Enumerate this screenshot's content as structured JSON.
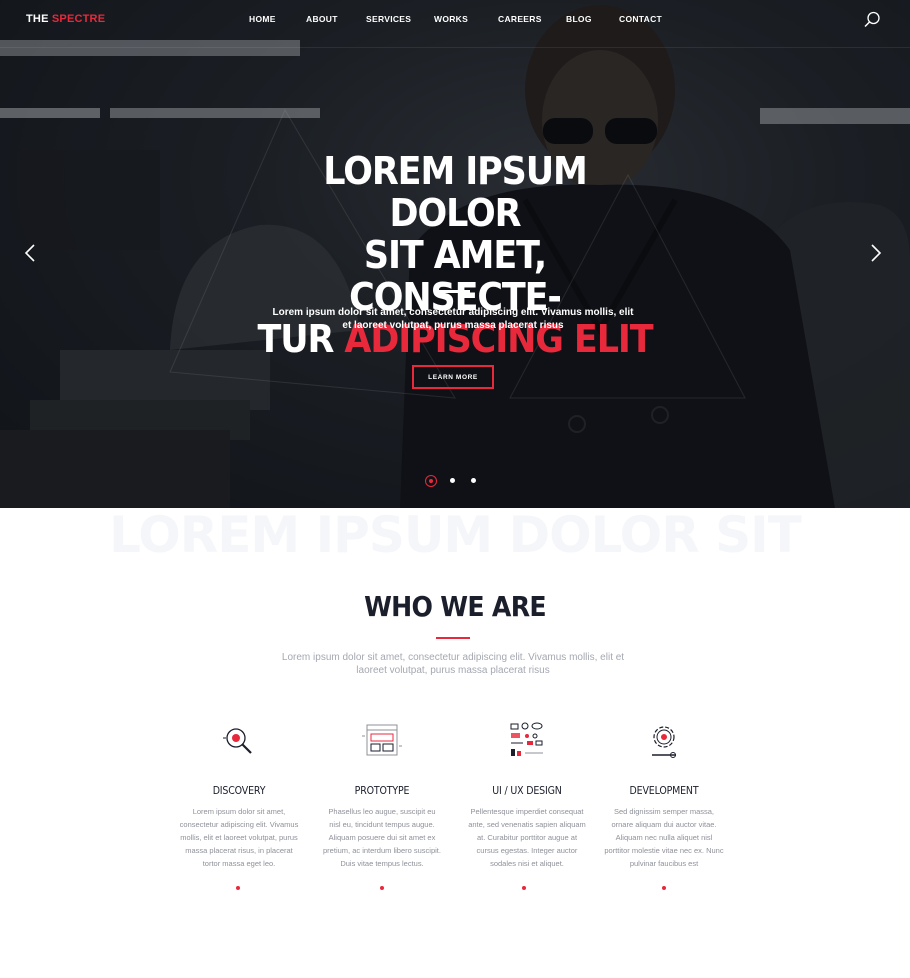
{
  "brand": {
    "part1": "THE",
    "part2": "SPECTRE"
  },
  "nav": {
    "items": [
      {
        "label": "HOME"
      },
      {
        "label": "ABOUT"
      },
      {
        "label": "SERVICES"
      },
      {
        "label": "WORKS"
      },
      {
        "label": "CAREERS"
      },
      {
        "label": "BLOG"
      },
      {
        "label": "CONTACT"
      }
    ],
    "search_icon": "search-icon"
  },
  "hero": {
    "title_line1": "LOREM IPSUM DOLOR",
    "title_line2": "SIT AMET, CONSECTE-",
    "title_line3_white": "TUR ",
    "title_line3_red": "ADIPISCING ELIT",
    "subtitle": "Lorem ipsum dolor sit amet, consectetur adipiscing elit. Vivamus mollis, elit et laoreet volutpat, purus massa placerat risus",
    "button_label": "LEARN MORE",
    "slides_total": 3,
    "active_slide": 1
  },
  "about": {
    "watermark": "LOREM IPSUM DOLOR SIT",
    "title": "WHO WE ARE",
    "subtitle": "Lorem ipsum dolor sit amet, consectetur adipiscing elit. Vivamus mollis, elit et laoreet volutpat, purus massa placerat risus",
    "features": [
      {
        "title": "DISCOVERY",
        "icon": "magnifier-icon",
        "text": "Lorem ipsum dolor sit amet, consectetur adipiscing elit. Vivamus mollis, elit et laoreet volutpat, purus massa placerat risus, in placerat tortor massa eget leo."
      },
      {
        "title": "PROTOTYPE",
        "icon": "browser-wireframe-icon",
        "text": "Phasellus leo augue, suscipit eu nisl eu, tincidunt tempus augue. Aliquam posuere dui sit amet ex pretium, ac interdum libero suscipit. Duis vitae tempus lectus."
      },
      {
        "title": "UI / UX DESIGN",
        "icon": "ui-elements-icon",
        "text": "Pellentesque imperdiet consequat ante, sed venenatis sapien aliquam at. Curabitur porttitor augue at cursus egestas. Integer auctor sodales nisi et aliquet."
      },
      {
        "title": "DEVELOPMENT",
        "icon": "gear-wrench-icon",
        "text": "Sed dignissim semper massa, ornare aliquam dui auctor vitae. Aliquam nec nulla aliquet nisl porttitor molestie vitae nec ex. Nunc pulvinar faucibus est"
      }
    ]
  },
  "colors": {
    "accent": "#e8293c",
    "dark": "#1b1e2b",
    "muted": "#a5a8b1"
  }
}
